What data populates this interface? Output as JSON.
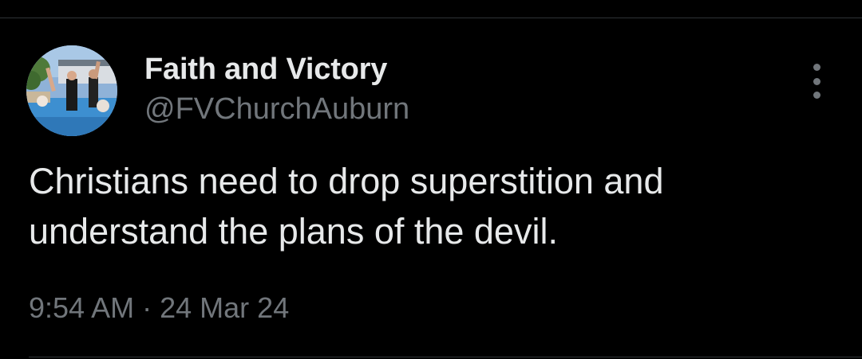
{
  "tweet": {
    "author": {
      "display_name": "Faith and Victory",
      "handle": "@FVChurchAuburn",
      "avatar": "profile-photo"
    },
    "text": "Christians need to drop superstition and understand the plans of the devil.",
    "time": "9:54 AM",
    "separator": "·",
    "date": "24 Mar 24",
    "more_icon": "more-vertical-icon"
  },
  "colors": {
    "background": "#000000",
    "primary_text": "#e7e9ea",
    "secondary_text": "#71767b",
    "divider": "#2f3336"
  }
}
